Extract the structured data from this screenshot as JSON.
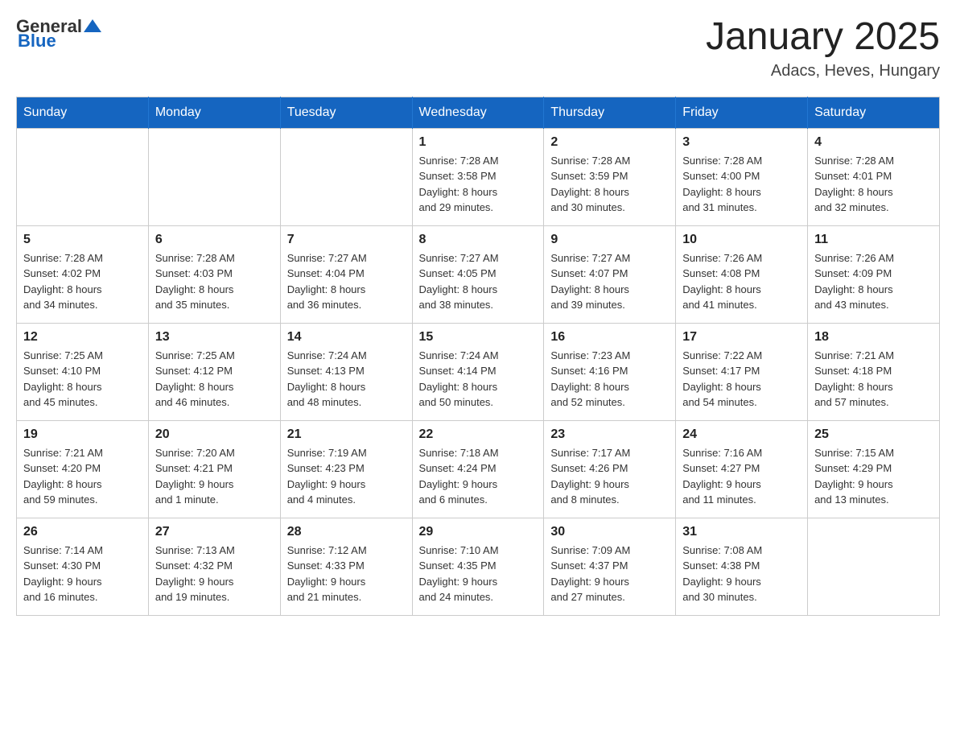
{
  "header": {
    "logo_general": "General",
    "logo_blue": "Blue",
    "title": "January 2025",
    "subtitle": "Adacs, Heves, Hungary"
  },
  "weekdays": [
    "Sunday",
    "Monday",
    "Tuesday",
    "Wednesday",
    "Thursday",
    "Friday",
    "Saturday"
  ],
  "weeks": [
    [
      {
        "day": "",
        "info": ""
      },
      {
        "day": "",
        "info": ""
      },
      {
        "day": "",
        "info": ""
      },
      {
        "day": "1",
        "info": "Sunrise: 7:28 AM\nSunset: 3:58 PM\nDaylight: 8 hours\nand 29 minutes."
      },
      {
        "day": "2",
        "info": "Sunrise: 7:28 AM\nSunset: 3:59 PM\nDaylight: 8 hours\nand 30 minutes."
      },
      {
        "day": "3",
        "info": "Sunrise: 7:28 AM\nSunset: 4:00 PM\nDaylight: 8 hours\nand 31 minutes."
      },
      {
        "day": "4",
        "info": "Sunrise: 7:28 AM\nSunset: 4:01 PM\nDaylight: 8 hours\nand 32 minutes."
      }
    ],
    [
      {
        "day": "5",
        "info": "Sunrise: 7:28 AM\nSunset: 4:02 PM\nDaylight: 8 hours\nand 34 minutes."
      },
      {
        "day": "6",
        "info": "Sunrise: 7:28 AM\nSunset: 4:03 PM\nDaylight: 8 hours\nand 35 minutes."
      },
      {
        "day": "7",
        "info": "Sunrise: 7:27 AM\nSunset: 4:04 PM\nDaylight: 8 hours\nand 36 minutes."
      },
      {
        "day": "8",
        "info": "Sunrise: 7:27 AM\nSunset: 4:05 PM\nDaylight: 8 hours\nand 38 minutes."
      },
      {
        "day": "9",
        "info": "Sunrise: 7:27 AM\nSunset: 4:07 PM\nDaylight: 8 hours\nand 39 minutes."
      },
      {
        "day": "10",
        "info": "Sunrise: 7:26 AM\nSunset: 4:08 PM\nDaylight: 8 hours\nand 41 minutes."
      },
      {
        "day": "11",
        "info": "Sunrise: 7:26 AM\nSunset: 4:09 PM\nDaylight: 8 hours\nand 43 minutes."
      }
    ],
    [
      {
        "day": "12",
        "info": "Sunrise: 7:25 AM\nSunset: 4:10 PM\nDaylight: 8 hours\nand 45 minutes."
      },
      {
        "day": "13",
        "info": "Sunrise: 7:25 AM\nSunset: 4:12 PM\nDaylight: 8 hours\nand 46 minutes."
      },
      {
        "day": "14",
        "info": "Sunrise: 7:24 AM\nSunset: 4:13 PM\nDaylight: 8 hours\nand 48 minutes."
      },
      {
        "day": "15",
        "info": "Sunrise: 7:24 AM\nSunset: 4:14 PM\nDaylight: 8 hours\nand 50 minutes."
      },
      {
        "day": "16",
        "info": "Sunrise: 7:23 AM\nSunset: 4:16 PM\nDaylight: 8 hours\nand 52 minutes."
      },
      {
        "day": "17",
        "info": "Sunrise: 7:22 AM\nSunset: 4:17 PM\nDaylight: 8 hours\nand 54 minutes."
      },
      {
        "day": "18",
        "info": "Sunrise: 7:21 AM\nSunset: 4:18 PM\nDaylight: 8 hours\nand 57 minutes."
      }
    ],
    [
      {
        "day": "19",
        "info": "Sunrise: 7:21 AM\nSunset: 4:20 PM\nDaylight: 8 hours\nand 59 minutes."
      },
      {
        "day": "20",
        "info": "Sunrise: 7:20 AM\nSunset: 4:21 PM\nDaylight: 9 hours\nand 1 minute."
      },
      {
        "day": "21",
        "info": "Sunrise: 7:19 AM\nSunset: 4:23 PM\nDaylight: 9 hours\nand 4 minutes."
      },
      {
        "day": "22",
        "info": "Sunrise: 7:18 AM\nSunset: 4:24 PM\nDaylight: 9 hours\nand 6 minutes."
      },
      {
        "day": "23",
        "info": "Sunrise: 7:17 AM\nSunset: 4:26 PM\nDaylight: 9 hours\nand 8 minutes."
      },
      {
        "day": "24",
        "info": "Sunrise: 7:16 AM\nSunset: 4:27 PM\nDaylight: 9 hours\nand 11 minutes."
      },
      {
        "day": "25",
        "info": "Sunrise: 7:15 AM\nSunset: 4:29 PM\nDaylight: 9 hours\nand 13 minutes."
      }
    ],
    [
      {
        "day": "26",
        "info": "Sunrise: 7:14 AM\nSunset: 4:30 PM\nDaylight: 9 hours\nand 16 minutes."
      },
      {
        "day": "27",
        "info": "Sunrise: 7:13 AM\nSunset: 4:32 PM\nDaylight: 9 hours\nand 19 minutes."
      },
      {
        "day": "28",
        "info": "Sunrise: 7:12 AM\nSunset: 4:33 PM\nDaylight: 9 hours\nand 21 minutes."
      },
      {
        "day": "29",
        "info": "Sunrise: 7:10 AM\nSunset: 4:35 PM\nDaylight: 9 hours\nand 24 minutes."
      },
      {
        "day": "30",
        "info": "Sunrise: 7:09 AM\nSunset: 4:37 PM\nDaylight: 9 hours\nand 27 minutes."
      },
      {
        "day": "31",
        "info": "Sunrise: 7:08 AM\nSunset: 4:38 PM\nDaylight: 9 hours\nand 30 minutes."
      },
      {
        "day": "",
        "info": ""
      }
    ]
  ]
}
